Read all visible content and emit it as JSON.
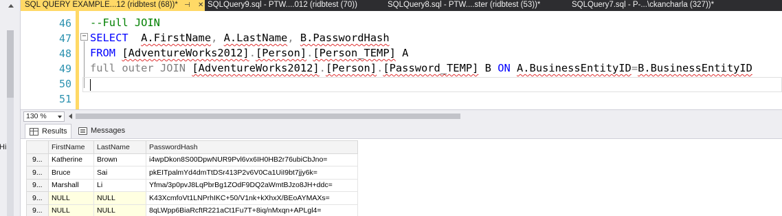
{
  "left_panel": {
    "peek_text": "Hi"
  },
  "tabs": [
    {
      "label": "SQL QUERY EXAMPLE...12 (ridbtest (68))*",
      "active": true,
      "pin": "⊣",
      "close": "✕"
    },
    {
      "label": "SQLQuery9.sql - PTW....012 (ridbtest (70))",
      "active": false
    },
    {
      "label": "SQLQuery8.sql - PTW....ster (ridbtest (53))*",
      "active": false
    },
    {
      "label": "SQLQuery7.sql - P-...\\ckancharla (327))*",
      "active": false
    }
  ],
  "editor": {
    "line_numbers": [
      "46",
      "47",
      "48",
      "49",
      "50",
      "51"
    ],
    "collapse_glyph": "−",
    "line46": {
      "comment": "--Full JOIN"
    },
    "line47": {
      "kw": "SELECT",
      "t1": "  ",
      "a": "A.FirstName",
      "t2": ", ",
      "b": "A.LastName",
      "t3": ", ",
      "c": "B.PasswordHash"
    },
    "line48": {
      "kw": "FROM",
      "t1": " ",
      "db": "[AdventureWorks2012]",
      "dot1": ".",
      "sch": "[Person]",
      "dot2": ".",
      "tbl": "[Person_TEMP]",
      "alias": " A"
    },
    "line49": {
      "kw1": "full",
      "sp1": " ",
      "kw2": "outer",
      "sp2": " ",
      "kw3": "JOIN",
      "sp3": " ",
      "db": "[AdventureWorks2012]",
      "dot1": ".",
      "sch": "[Person]",
      "dot2": ".",
      "tbl": "[Password_TEMP]",
      "alias": " B ",
      "kw4": "ON",
      "sp4": " ",
      "cond_a": "A.BusinessEntityID",
      "eq": "=",
      "cond_b": "B.BusinessEntityID"
    }
  },
  "zoom": {
    "value": "130 %"
  },
  "results_tabs": {
    "results": "Results",
    "messages": "Messages"
  },
  "results": {
    "columns": [
      "FirstName",
      "LastName",
      "PasswordHash"
    ],
    "rows": [
      {
        "rownum": "9...",
        "first": "Katherine",
        "last": "Brown",
        "hash": "i4wpDkon8S00DpwNUR9Pvl6vx6IH0HB2r76ubiCbJno="
      },
      {
        "rownum": "9...",
        "first": "Bruce",
        "last": "Sai",
        "hash": "pkEITpalmYd4dmTtDSr413P2v6V0Ca1UiI9bt7jjy6k="
      },
      {
        "rownum": "9...",
        "first": "Marshall",
        "last": "Li",
        "hash": "Yfma/3p0pvJ8LqPbrBg1ZOdF9DQ2aWmtBJzo8JH+ddc="
      },
      {
        "rownum": "9...",
        "first": "NULL",
        "last": "NULL",
        "hash": "K43XcmfoVt1LNPrhIKC+50/V1nk+kXhxX/BEoAYMAXs="
      },
      {
        "rownum": "9...",
        "first": "NULL",
        "last": "NULL",
        "hash": "8qLWpp6BiaRcftR221aCt1Fu7T+8iq/nMxqn+APLgl4="
      }
    ]
  }
}
